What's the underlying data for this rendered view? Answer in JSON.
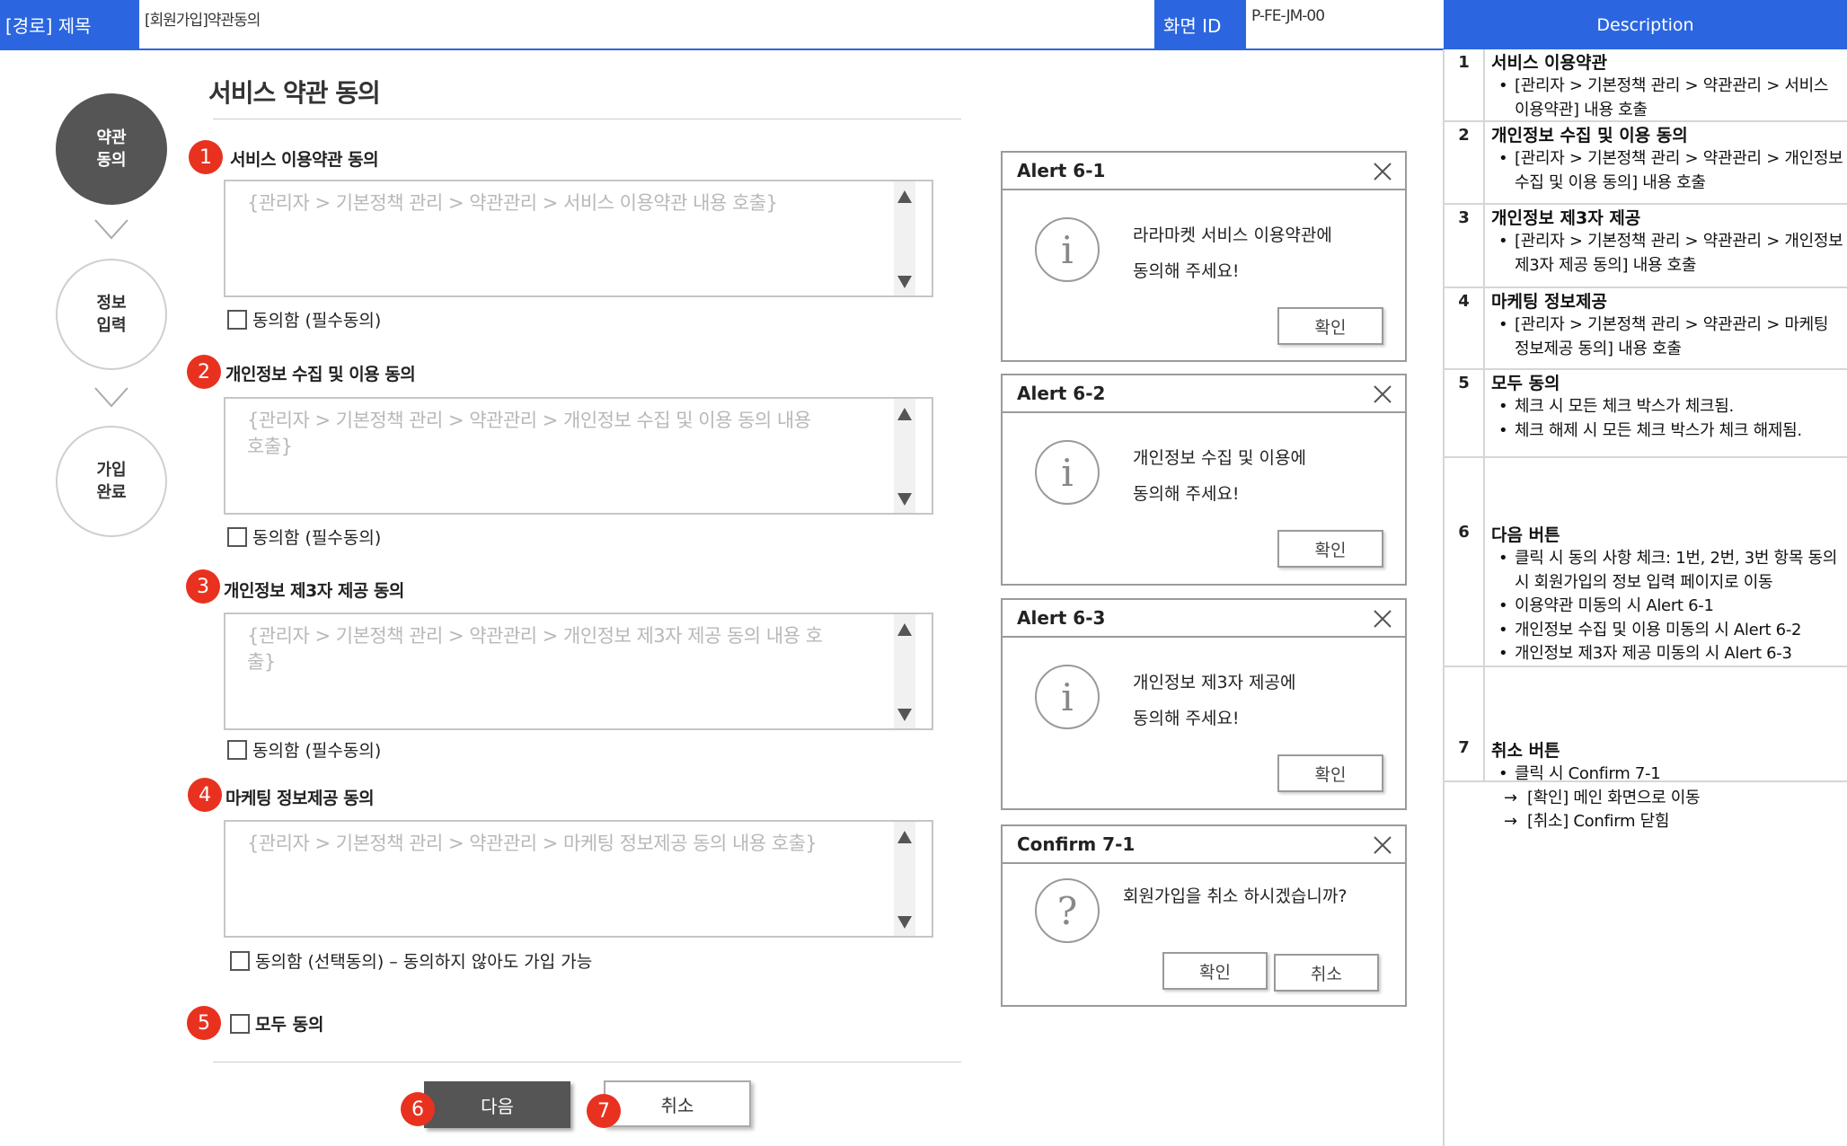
{
  "header": {
    "path_label": "[경로] 제목",
    "path_value": "[회원가입]약관동의",
    "screen_id_label": "화면 ID",
    "screen_id_value": "P-FE-JM-00",
    "description_label": "Description"
  },
  "steps": [
    {
      "label": "약관\n동의",
      "active": true
    },
    {
      "label": "정보\n입력",
      "active": false
    },
    {
      "label": "가입\n완료",
      "active": false
    }
  ],
  "main": {
    "title": "서비스 약관 동의",
    "sections": [
      {
        "badge": "1",
        "title": "서비스 이용약관 동의",
        "placeholder": "{관리자 > 기본정책 관리 > 약관관리 > 서비스 이용약관 내용 호출}",
        "checkbox": "동의함 (필수동의)"
      },
      {
        "badge": "2",
        "title": "개인정보 수집 및 이용 동의",
        "placeholder": "{관리자 > 기본정책 관리 > 약관관리 > 개인정보 수집 및 이용 동의 내용 호출}",
        "checkbox": "동의함 (필수동의)"
      },
      {
        "badge": "3",
        "title": "개인정보 제3자 제공 동의",
        "placeholder": "{관리자 > 기본정책 관리 > 약관관리 > 개인정보 제3자 제공 동의 내용 호출}",
        "checkbox": "동의함 (필수동의)"
      },
      {
        "badge": "4",
        "title": "마케팅 정보제공 동의",
        "placeholder": "{관리자 > 기본정책 관리 > 약관관리 > 마케팅 정보제공 동의 내용 호출}",
        "checkbox": "동의함 (선택동의) – 동의하지 않아도 가입 가능"
      }
    ],
    "agree_all": {
      "badge": "5",
      "label": "모두 동의"
    },
    "next_button": {
      "badge": "6",
      "label": "다음"
    },
    "cancel_button": {
      "badge": "7",
      "label": "취소"
    }
  },
  "dialogs": [
    {
      "title": "Alert 6-1",
      "line1": "라라마켓 서비스 이용약관에",
      "line2": "동의해 주세요!",
      "icon": "info-icon",
      "confirm": "확인"
    },
    {
      "title": "Alert 6-2",
      "line1": "개인정보 수집 및 이용에",
      "line2": "동의해 주세요!",
      "icon": "info-icon",
      "confirm": "확인"
    },
    {
      "title": "Alert 6-3",
      "line1": "개인정보 제3자 제공에",
      "line2": "동의해 주세요!",
      "icon": "info-icon",
      "confirm": "확인"
    },
    {
      "title": "Confirm 7-1",
      "line1": "회원가입을 취소 하시겠습니까?",
      "icon": "question-icon",
      "confirm": "확인",
      "cancel": "취소"
    }
  ],
  "description": [
    {
      "num": "1",
      "title": "서비스 이용약관",
      "items": [
        "[관리자 > 기본정책 관리 > 약관관리 > 서비스 이용약관] 내용 호출"
      ]
    },
    {
      "num": "2",
      "title": "개인정보 수집 및 이용 동의",
      "items": [
        "[관리자 > 기본정책 관리 > 약관관리 > 개인정보 수집 및 이용 동의] 내용 호출"
      ]
    },
    {
      "num": "3",
      "title": "개인정보 제3자 제공",
      "items": [
        "[관리자 > 기본정책 관리 > 약관관리 > 개인정보 제3자 제공 동의] 내용 호출"
      ]
    },
    {
      "num": "4",
      "title": "마케팅 정보제공",
      "items": [
        "[관리자 > 기본정책 관리 > 약관관리 > 마케팅 정보제공 동의] 내용 호출"
      ]
    },
    {
      "num": "5",
      "title": "모두 동의",
      "items": [
        "체크 시 모든 체크 박스가 체크됨.",
        "체크 해제 시 모든 체크 박스가 체크 해제됨."
      ]
    },
    {
      "num": "6",
      "title": "다음 버튼",
      "items": [
        "클릭 시 동의 사항 체크: 1번, 2번, 3번 항목 동의 시 회원가입의 정보 입력 페이지로 이동",
        "이용약관 미동의 시 Alert 6-1",
        "개인정보 수집 및 이용 미동의 시 Alert 6-2",
        "개인정보 제3자 제공 미동의 시 Alert 6-3"
      ]
    },
    {
      "num": "7",
      "title": "취소 버튼",
      "items": [
        "클릭 시 Confirm 7-1"
      ],
      "subitems": [
        "[확인]  메인 화면으로 이동",
        "[취소]  Confirm 닫힘"
      ]
    }
  ],
  "colors": {
    "header_blue": "#2b66e0",
    "badge_red": "#e8321f",
    "button_dark": "#555555"
  }
}
